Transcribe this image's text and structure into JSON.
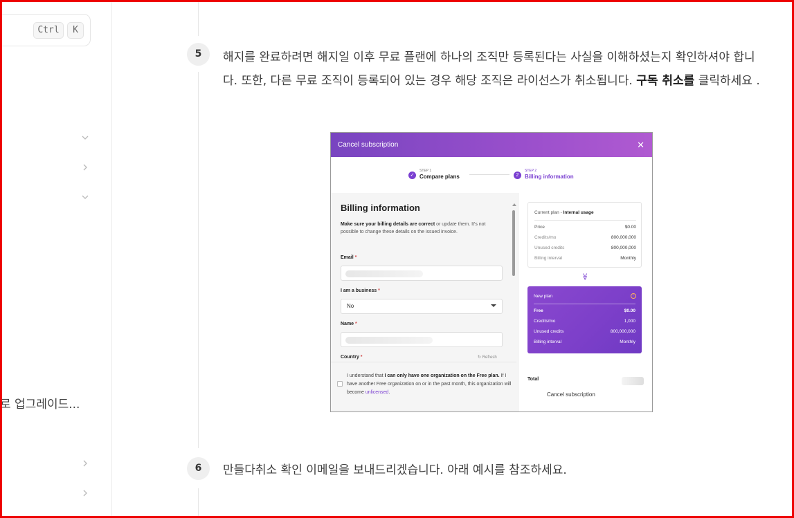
{
  "sidebar": {
    "search_kbd_ctrl": "Ctrl",
    "search_kbd_k": "K",
    "truncated_item_label": "로 업그레이드..."
  },
  "steps": [
    {
      "number": "5",
      "text_part1": "해지를 완료하려면 해지일 이후 무료 플랜에 하나의 조직만 등록된다는 사실을 이해하셨는지 확인하셔야 합니다. 또한, 다른 무료 조직이 등록되어 있는 경우 해당 조직은 라이선스가 취소됩니다. ",
      "text_bold": "구독 취소를",
      "text_part2": " 클릭하세요 ."
    },
    {
      "number": "6",
      "text": "만들다취소 확인 이메일을 보내드리겠습니다. 아래 예시를 참조하세요."
    }
  ],
  "modal": {
    "title": "Cancel subscription",
    "close_glyph": "✕",
    "stepper": {
      "step1_small": "STEP 1",
      "step1_label": "Compare plans",
      "step1_icon": "✓",
      "step2_small": "STEP 2",
      "step2_label": "Billing information",
      "step2_number": "2"
    },
    "billing": {
      "title": "Billing information",
      "desc_bold": "Make sure your billing details are correct",
      "desc_rest": " or update them. It's not possible to change these details on the issued invoice.",
      "email_label": "Email",
      "business_label": "I am a business",
      "business_value": "No",
      "name_label": "Name",
      "country_label": "Country",
      "required_mark": "*",
      "refresh_label": "↻ Refresh"
    },
    "consent": {
      "part1": "I understand that ",
      "bold1": "I can only have one organization on the Free plan.",
      "part2": " If I have another Free organization on or in the past month, this organization will become ",
      "link": "unlicensed",
      "part3": "."
    },
    "current_plan": {
      "head_prefix": "Current plan - ",
      "head_name": "Internal usage",
      "rows": [
        {
          "label": "Price",
          "value": "$0.00"
        },
        {
          "label": "Credits/mo",
          "value": "800,000,000"
        },
        {
          "label": "Unused credits",
          "value": "800,000,000"
        },
        {
          "label": "Billing interval",
          "value": "Monthly"
        }
      ]
    },
    "arrow_glyph": "≫",
    "new_plan": {
      "head": "New plan",
      "info_glyph": "!",
      "rows": [
        {
          "label": "Free",
          "value": "$0.00"
        },
        {
          "label": "Credits/mo",
          "value": "1,000"
        },
        {
          "label": "Unused credits",
          "value": "800,000,000"
        },
        {
          "label": "Billing interval",
          "value": "Monthly"
        }
      ]
    },
    "total_label": "Total",
    "cancel_label": "Cancel subscription"
  }
}
